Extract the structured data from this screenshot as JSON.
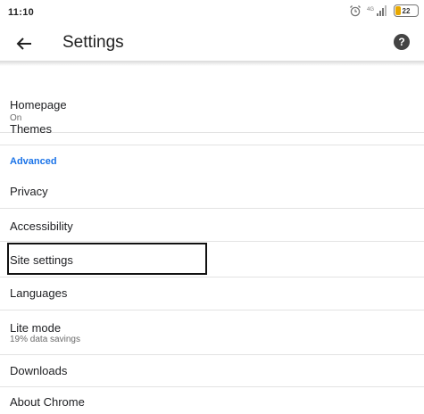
{
  "status_bar": {
    "time": "11:10",
    "battery_level": "22",
    "icons": [
      "alarm-icon",
      "signal-icon",
      "battery-icon"
    ]
  },
  "toolbar": {
    "title": "Settings",
    "back_icon": "back-arrow-icon",
    "help_icon": "help-icon",
    "help_glyph": "?"
  },
  "settings": {
    "homepage": {
      "label": "Homepage",
      "value": "On"
    },
    "themes": {
      "label": "Themes"
    },
    "advanced_header": "Advanced",
    "privacy": {
      "label": "Privacy"
    },
    "accessibility": {
      "label": "Accessibility"
    },
    "site_settings": {
      "label": "Site settings"
    },
    "languages": {
      "label": "Languages"
    },
    "lite_mode": {
      "label": "Lite mode",
      "subtitle": "19% data savings"
    },
    "downloads": {
      "label": "Downloads"
    },
    "about_chrome": {
      "label": "About Chrome"
    }
  },
  "colors": {
    "accent": "#1a73e8",
    "divider": "#e3e3e3",
    "highlight_border": "#111111"
  }
}
